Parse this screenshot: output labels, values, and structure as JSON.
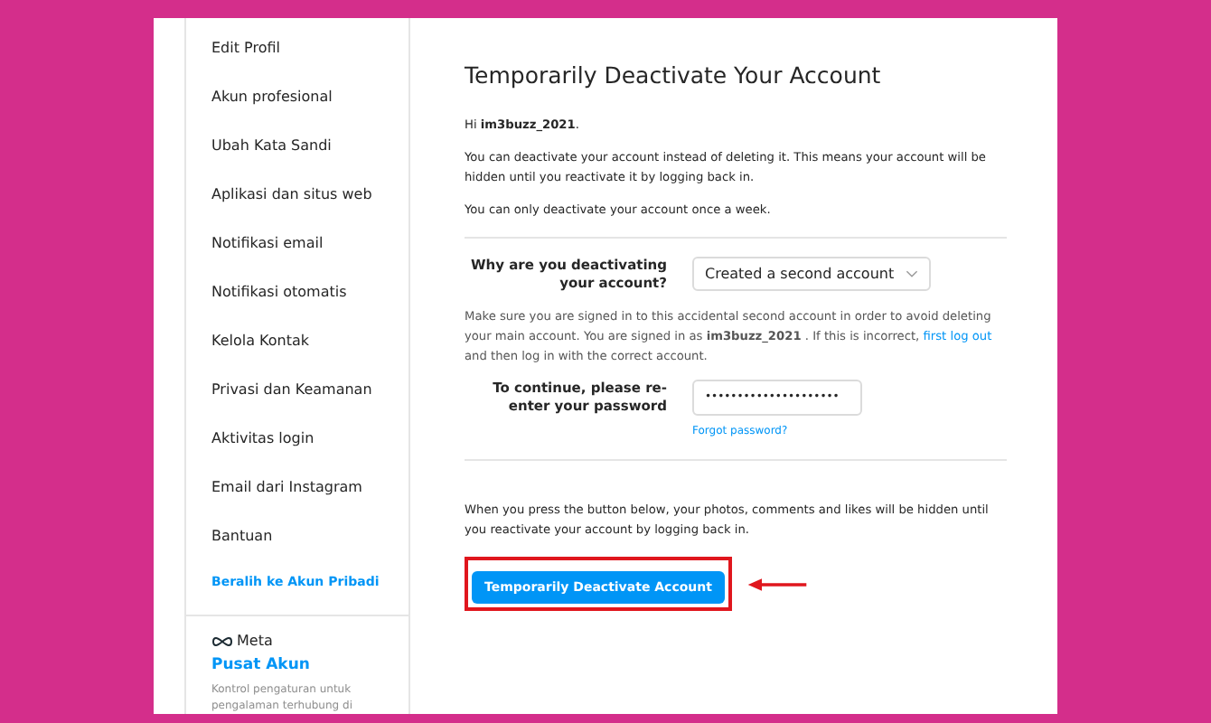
{
  "sidebar": {
    "items": [
      {
        "label": "Edit Profil",
        "kind": "item"
      },
      {
        "label": "Akun profesional",
        "kind": "item"
      },
      {
        "label": "Ubah Kata Sandi",
        "kind": "item"
      },
      {
        "label": "Aplikasi dan situs web",
        "kind": "item"
      },
      {
        "label": "Notifikasi email",
        "kind": "item"
      },
      {
        "label": "Notifikasi otomatis",
        "kind": "item"
      },
      {
        "label": "Kelola Kontak",
        "kind": "item"
      },
      {
        "label": "Privasi dan Keamanan",
        "kind": "item"
      },
      {
        "label": "Aktivitas login",
        "kind": "item"
      },
      {
        "label": "Email dari Instagram",
        "kind": "item"
      },
      {
        "label": "Bantuan",
        "kind": "item"
      },
      {
        "label": "Beralih ke Akun Pribadi",
        "kind": "link"
      }
    ],
    "brand": "Meta",
    "center_link": "Pusat Akun",
    "center_text": "Kontrol pengaturan untuk pengalaman terhubung di"
  },
  "main": {
    "title": "Temporarily Deactivate Your Account",
    "greeting": "Hi **im3buzz_2021**.",
    "intro": "You can deactivate your account instead of deleting it. This means your account will be hidden until you reactivate it by logging back in.",
    "limit": "You can only deactivate your account once a week.",
    "reason_label": "Why are you deactivating your account?",
    "reason_value": "Created a second account",
    "note_before": "Make sure you are signed in to this accidental second account in order to avoid deleting your main account. You are signed in as **im3buzz_2021** . If this is incorrect,",
    "note_link": "first log out",
    "note_after": "and then log in with the correct account.",
    "password_label": "To continue, please re-enter your password",
    "password_value": "•••••••••••••••••••••",
    "forgot": "Forgot password?",
    "warning": "When you press the button below, your photos, comments and likes will be hidden until you reactivate your account by logging back in.",
    "button": "Temporarily Deactivate Account",
    "highlighted": true
  }
}
